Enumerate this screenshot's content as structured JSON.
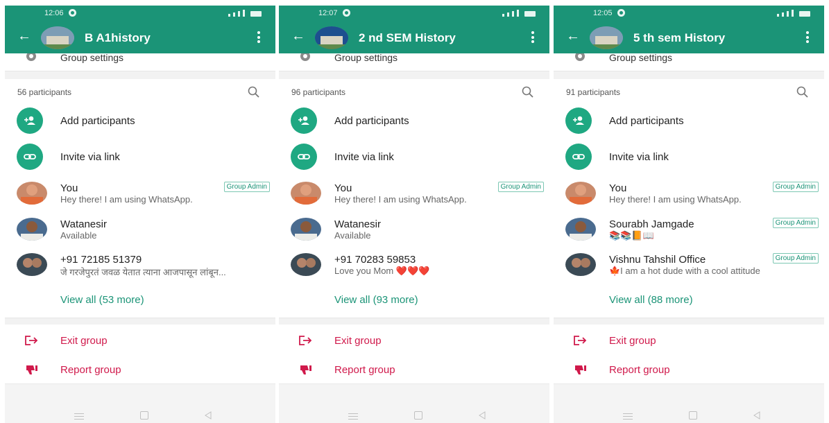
{
  "colors": {
    "header": "#1b9477",
    "accent_green": "#1fa882",
    "danger": "#d0194b",
    "badge_border": "#7cc7b3"
  },
  "panels": [
    {
      "status_time": "12:06",
      "group_title": "B A1history",
      "settings_label": "Group settings",
      "participants_count": "56 participants",
      "add_label": "Add participants",
      "invite_label": "Invite via link",
      "members": [
        {
          "name": "You",
          "status": "Hey there! I am using WhatsApp.",
          "badge": "Group Admin"
        },
        {
          "name": "Watanesir",
          "status": "Available",
          "badge": ""
        },
        {
          "name": "+91 72185 51379",
          "status": "जे गरजेपुरतं जवळ येतात त्याना आजपासून लांबून...",
          "badge": ""
        }
      ],
      "view_all": "View all (53 more)",
      "exit_label": "Exit group",
      "report_label": "Report group"
    },
    {
      "status_time": "12:07",
      "group_title": "2 nd SEM  History",
      "settings_label": "Group settings",
      "participants_count": "96 participants",
      "add_label": "Add participants",
      "invite_label": "Invite via link",
      "members": [
        {
          "name": "You",
          "status": "Hey there! I am using WhatsApp.",
          "badge": "Group Admin"
        },
        {
          "name": "Watanesir",
          "status": "Available",
          "badge": ""
        },
        {
          "name": "+91 70283 59853",
          "status": "Love you Mom ❤️❤️❤️",
          "badge": ""
        }
      ],
      "view_all": "View all (93 more)",
      "exit_label": "Exit group",
      "report_label": "Report group"
    },
    {
      "status_time": "12:05",
      "group_title": "5 th sem History",
      "settings_label": "Group settings",
      "participants_count": "91 participants",
      "add_label": "Add participants",
      "invite_label": "Invite via link",
      "members": [
        {
          "name": "You",
          "status": "Hey there! I am using WhatsApp.",
          "badge": "Group Admin"
        },
        {
          "name": "Sourabh Jamgade",
          "status": "📚📚📙📖",
          "badge": "Group Admin"
        },
        {
          "name": "Vishnu Tahshil Office",
          "status": "🍁I am a hot dude with a cool attitude",
          "badge": "Group Admin"
        }
      ],
      "view_all": "View all (88 more)",
      "exit_label": "Exit group",
      "report_label": "Report group"
    }
  ]
}
